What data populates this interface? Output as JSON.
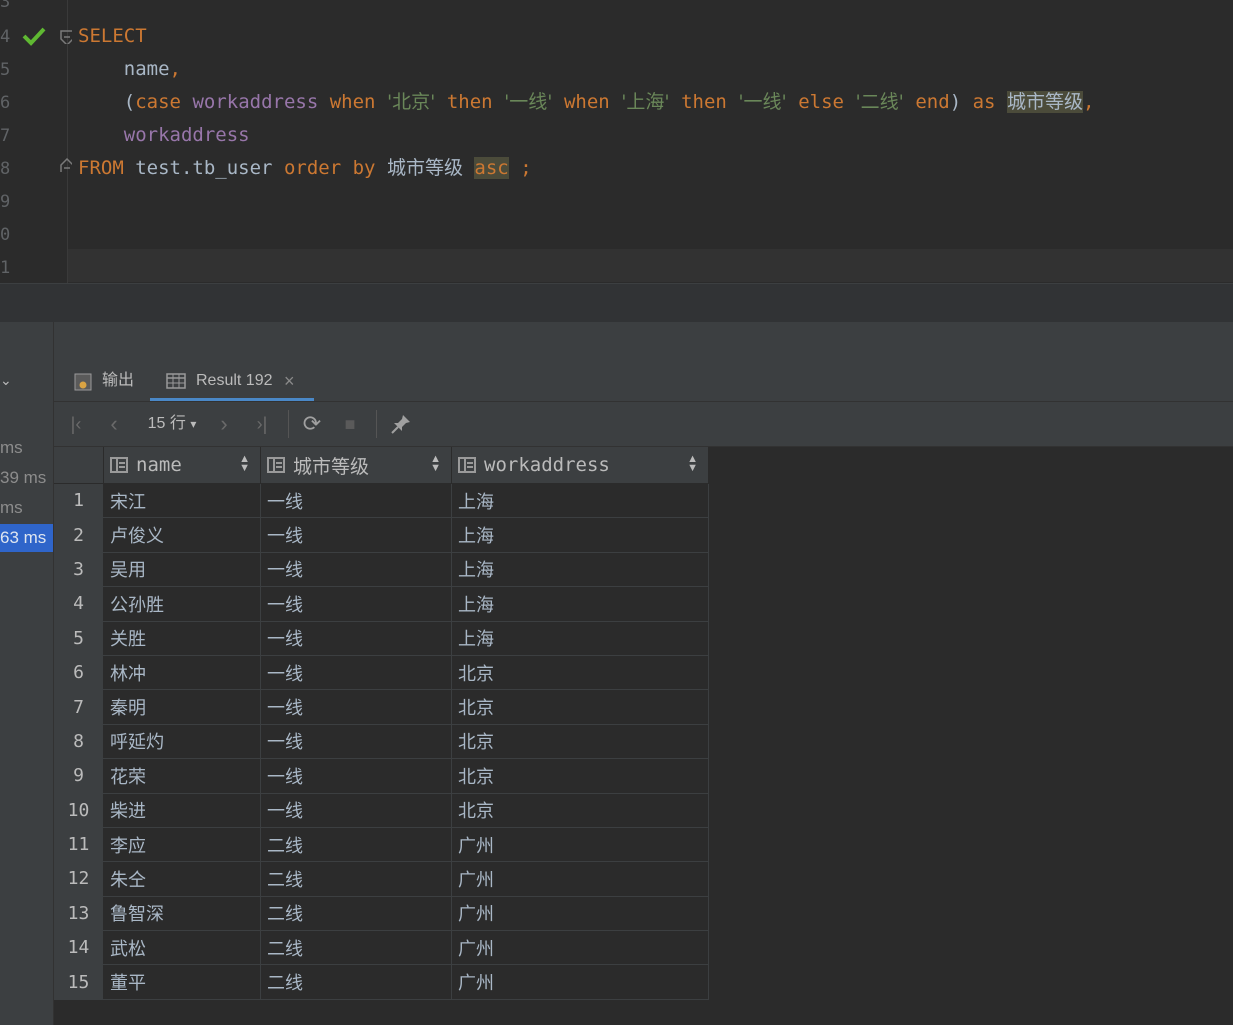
{
  "editor": {
    "line_numbers": [
      "3",
      "4",
      "5",
      "6",
      "7",
      "8",
      "9",
      "0",
      "1"
    ],
    "lines": {
      "l4": {
        "select": "SELECT"
      },
      "l5": {
        "name": "name",
        "comma": ","
      },
      "l6": {
        "paren_open": "(",
        "case": "case",
        "col": "workaddress",
        "when1": "when",
        "str1": "'北京'",
        "then1": "then",
        "str2": "'一线'",
        "when2": "when",
        "str3": "'上海'",
        "then2": "then",
        "str4": "'一线'",
        "else": "else",
        "str5": "'二线'",
        "end": "end",
        "paren_close": ")",
        "as": "as",
        "alias": "城市等级",
        "comma": ","
      },
      "l7": {
        "col": "workaddress"
      },
      "l8": {
        "from": "FROM",
        "table": "test.tb_user",
        "order": "order",
        "by": "by",
        "alias": "城市等级",
        "asc": "asc",
        "semicolon": ";"
      }
    }
  },
  "left_strip": {
    "timings": [
      "ms",
      "39 ms",
      "ms",
      "63 ms"
    ],
    "arrow": "⌄"
  },
  "tabs": [
    {
      "label": "输出"
    },
    {
      "label": "Result 192",
      "close": "×"
    }
  ],
  "toolbar": {
    "rows_label": "15 行",
    "first": "|‹",
    "prev": "‹",
    "next": "›",
    "last": "›|",
    "refresh": "⟳",
    "stop": "■",
    "pin": "📌"
  },
  "table": {
    "columns": [
      "name",
      "城市等级",
      "workaddress"
    ],
    "rows": [
      [
        "1",
        "宋江",
        "一线",
        "上海"
      ],
      [
        "2",
        "卢俊义",
        "一线",
        "上海"
      ],
      [
        "3",
        "吴用",
        "一线",
        "上海"
      ],
      [
        "4",
        "公孙胜",
        "一线",
        "上海"
      ],
      [
        "5",
        "关胜",
        "一线",
        "上海"
      ],
      [
        "6",
        "林冲",
        "一线",
        "北京"
      ],
      [
        "7",
        "秦明",
        "一线",
        "北京"
      ],
      [
        "8",
        "呼延灼",
        "一线",
        "北京"
      ],
      [
        "9",
        "花荣",
        "一线",
        "北京"
      ],
      [
        "10",
        "柴进",
        "一线",
        "北京"
      ],
      [
        "11",
        "李应",
        "二线",
        "广州"
      ],
      [
        "12",
        "朱仝",
        "二线",
        "广州"
      ],
      [
        "13",
        "鲁智深",
        "二线",
        "广州"
      ],
      [
        "14",
        "武松",
        "二线",
        "广州"
      ],
      [
        "15",
        "董平",
        "二线",
        "广州"
      ]
    ]
  }
}
